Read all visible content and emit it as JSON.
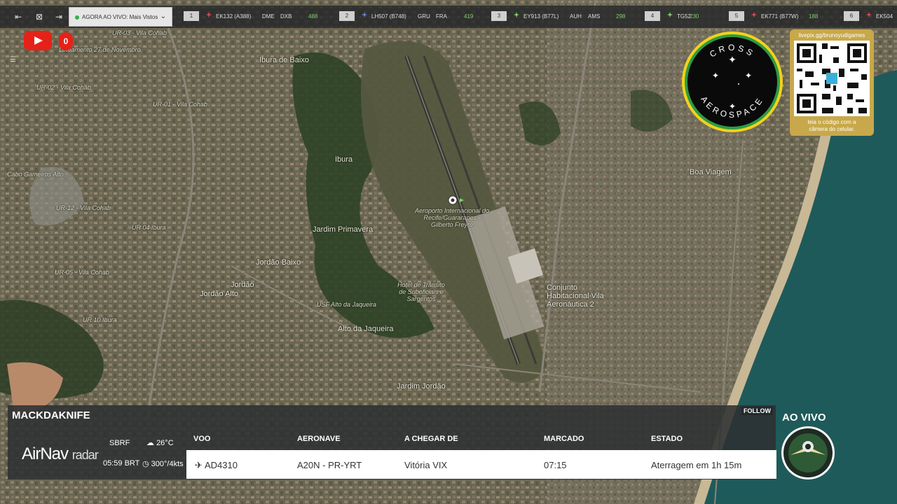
{
  "topbar": {
    "view_selector": "AGORA AO VIVO: Mais Vistos",
    "flights": [
      {
        "rank": "1",
        "callsign": "EK132 (A388)",
        "origin": "DME",
        "dest": "DXB",
        "count": "488",
        "color": "#e0485a"
      },
      {
        "rank": "2",
        "callsign": "LH507 (B748)",
        "origin": "GRU",
        "dest": "FRA",
        "count": "419",
        "color": "#6c7fd8"
      },
      {
        "rank": "3",
        "callsign": "EY913 (B77L)",
        "origin": "AUH",
        "dest": "AMS",
        "count": "298",
        "color": "#7fd06b"
      },
      {
        "rank": "4",
        "callsign": "TG52",
        "origin": "",
        "dest": "",
        "count": "230",
        "color": "#7fd06b"
      },
      {
        "rank": "5",
        "callsign": "EK771 (B77W)",
        "origin": "",
        "dest": "",
        "count": "188",
        "color": "#e0485a"
      },
      {
        "rank": "6",
        "callsign": "EK504",
        "origin": "",
        "dest": "",
        "count": "",
        "color": "#e0485a"
      }
    ]
  },
  "youtube": {
    "badge": "0"
  },
  "logo": {
    "text_top": "CROSS",
    "text_bottom": "AEROSPACE"
  },
  "qr": {
    "url": "livepix.gg/brunoyudigames",
    "hint_line1": "leia o código com a",
    "hint_line2": "câmera do celular."
  },
  "map": {
    "labels": [
      "UR-03 - Vila Cohab",
      "Loteamento 27 de Novembro",
      "UR-02 - Vila Cohab",
      "UR-01 - Vila Cohab",
      "Ibura de Baixo",
      "Ibura",
      "Aeroporto Internacional do Recife/Guararapes - Gilberto Freyre",
      "Jardim Primavera",
      "Jordão Baixo",
      "Jordão",
      "Jordão Alto",
      "UR-12 - Vila Cohab",
      "UR 04 Ibura",
      "UR-05 - Vila Cohab",
      "UR 10 Ibura",
      "Alto da Jaqueira",
      "Jardim Jordão",
      "Boa Viagem",
      "Conjunto Habitacional Vila Aeronáutica 2",
      "USF Alto da Jaqueira",
      "Hotel de Trânsito de Suboficiais e Sargentos",
      "Cabo Gameiros Alto"
    ]
  },
  "panel": {
    "username": "MACKDAKNIFE",
    "follow": "FOLLOW",
    "brand_main": "AirNav",
    "brand_sub": "radar",
    "airport": "SBRF",
    "time": "05:59 BRT",
    "temp": "26°C",
    "wind": "300°/4kts",
    "headers": {
      "voo": "VOO",
      "aeronave": "AERONAVE",
      "origem": "A CHEGAR DE",
      "marcado": "MARCADO",
      "estado": "ESTADO"
    },
    "row": {
      "voo": "AD4310",
      "aeronave": "A20N - PR-YRT",
      "origem": "Vitória VIX",
      "marcado": "07:15",
      "estado": "Aterragem em 1h 15m"
    }
  },
  "live_label": "AO VIVO"
}
